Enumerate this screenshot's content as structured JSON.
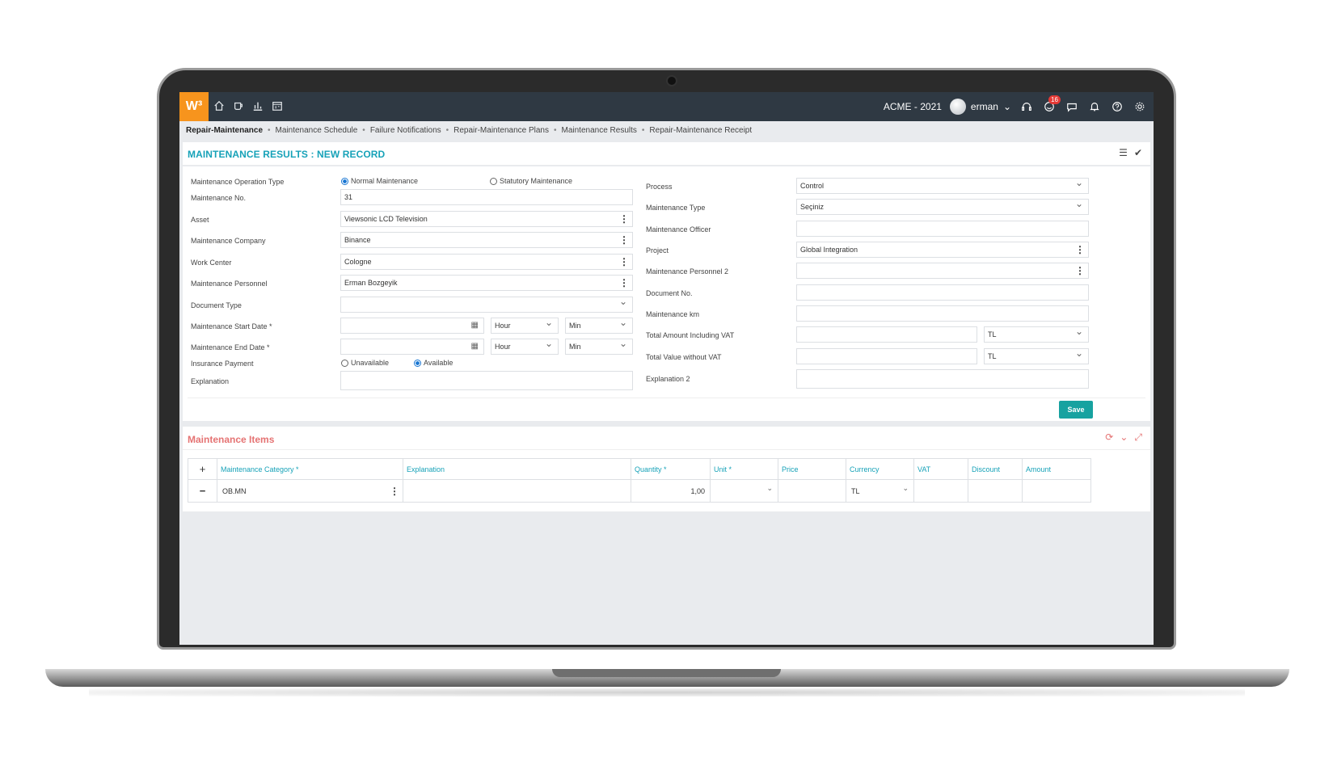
{
  "app": {
    "logo": "W³",
    "company": "ACME - 2021",
    "user": "erman",
    "notifications": "16"
  },
  "breadcrumb": [
    "Repair-Maintenance",
    "Maintenance Schedule",
    "Failure Notifications",
    "Repair-Maintenance Plans",
    "Maintenance Results",
    "Repair-Maintenance Receipt"
  ],
  "form": {
    "title": "MAINTENANCE RESULTS : NEW RECORD",
    "left": {
      "operation_type_label": "Maintenance Operation Type",
      "op_normal": "Normal Maintenance",
      "op_statutory": "Statutory Maintenance",
      "no_label": "Maintenance No.",
      "no_value": "31",
      "asset_label": "Asset",
      "asset_value": "Viewsonic LCD Television",
      "company_label": "Maintenance Company",
      "company_value": "Binance",
      "workcenter_label": "Work Center",
      "workcenter_value": "Cologne",
      "personnel_label": "Maintenance Personnel",
      "personnel_value": "Erman Bozgeyik",
      "doctype_label": "Document Type",
      "start_label": "Maintenance Start Date *",
      "end_label": "Maintenance End Date *",
      "hour": "Hour",
      "min": "Min",
      "insurance_label": "Insurance Payment",
      "ins_unavailable": "Unavailable",
      "ins_available": "Available",
      "explanation_label": "Explanation"
    },
    "right": {
      "process_label": "Process",
      "process_value": "Control",
      "type_label": "Maintenance Type",
      "type_value": "Seçiniz",
      "officer_label": "Maintenance Officer",
      "project_label": "Project",
      "project_value": "Global Integration",
      "personnel2_label": "Maintenance Personnel 2",
      "docno_label": "Document No.",
      "km_label": "Maintenance km",
      "total_vat_label": "Total Amount Including VAT",
      "total_novat_label": "Total Value without VAT",
      "currency": "TL",
      "explanation2_label": "Explanation 2"
    },
    "save_label": "Save"
  },
  "items": {
    "title": "Maintenance Items",
    "columns": [
      "Maintenance Category *",
      "Explanation",
      "Quantity *",
      "Unit *",
      "Price",
      "Currency",
      "VAT",
      "Discount",
      "Amount"
    ],
    "row": {
      "category": "OB.MN",
      "quantity": "1,00",
      "currency": "TL"
    }
  }
}
